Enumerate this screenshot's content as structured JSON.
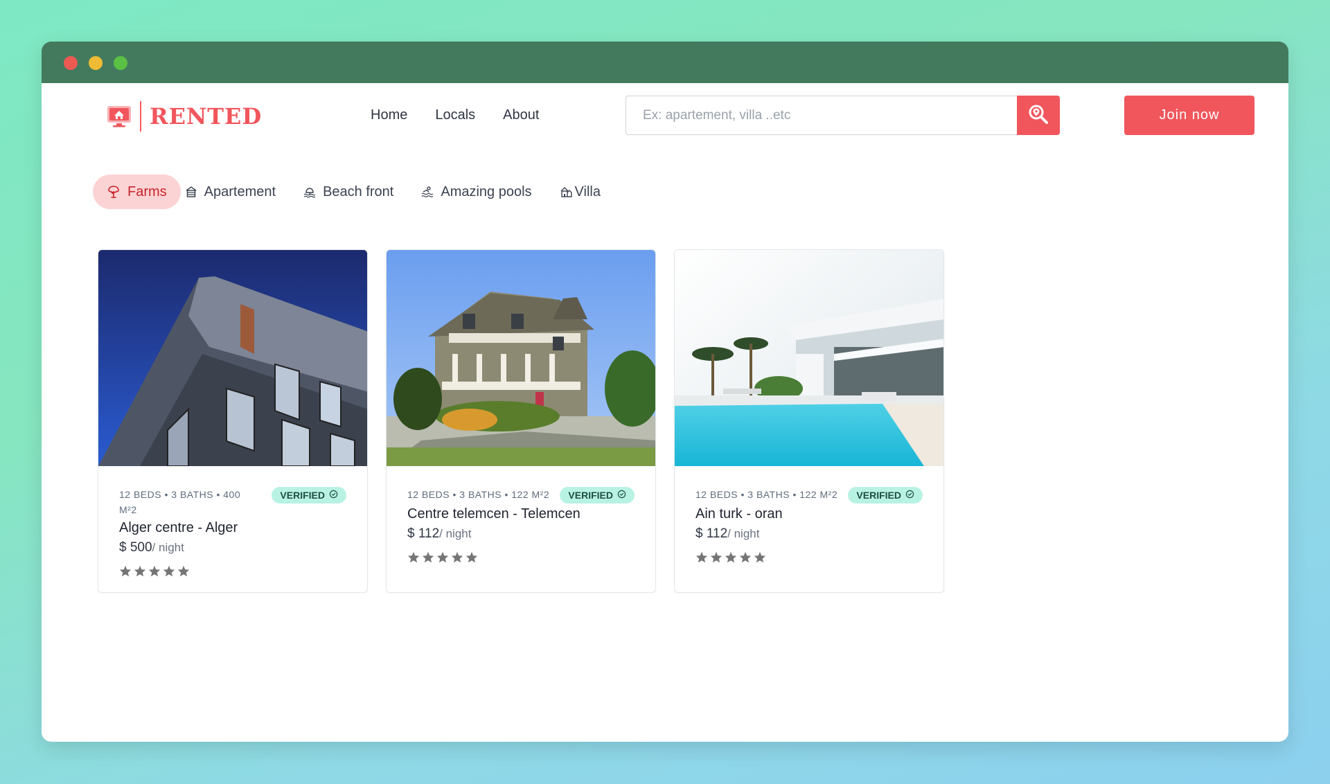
{
  "brand": {
    "name": "RENTED",
    "accent": "#f0565c"
  },
  "nav": {
    "links": [
      "Home",
      "Locals",
      "About"
    ]
  },
  "search": {
    "placeholder": "Ex: apartement, villa ..etc",
    "button_icon": "search-pin-icon"
  },
  "join": {
    "label": "Join now"
  },
  "categories": [
    {
      "label": "Farms",
      "icon": "tree-icon",
      "active": true
    },
    {
      "label": "Apartement",
      "icon": "building-icon",
      "active": false
    },
    {
      "label": "Beach front",
      "icon": "beach-icon",
      "active": false
    },
    {
      "label": "Amazing pools",
      "icon": "pool-icon",
      "active": false
    },
    {
      "label": "Villa",
      "icon": "villa-icon",
      "active": false
    }
  ],
  "listings": [
    {
      "meta": "12 BEDS • 3 BATHS • 400 M²2",
      "badge": "VERIFIED",
      "title": "Alger centre - Alger",
      "price": "$ 500",
      "per": "/ night",
      "stars": 5
    },
    {
      "meta": "12 BEDS • 3 BATHS • 122 M²2",
      "badge": "VERIFIED",
      "title": "Centre telemcen - Telemcen",
      "price": "$ 112",
      "per": "/ night",
      "stars": 5
    },
    {
      "meta": "12 BEDS • 3 BATHS • 122 M²2",
      "badge": "VERIFIED",
      "title": "Ain turk - oran",
      "price": "$ 112",
      "per": "/ night",
      "stars": 5
    }
  ]
}
